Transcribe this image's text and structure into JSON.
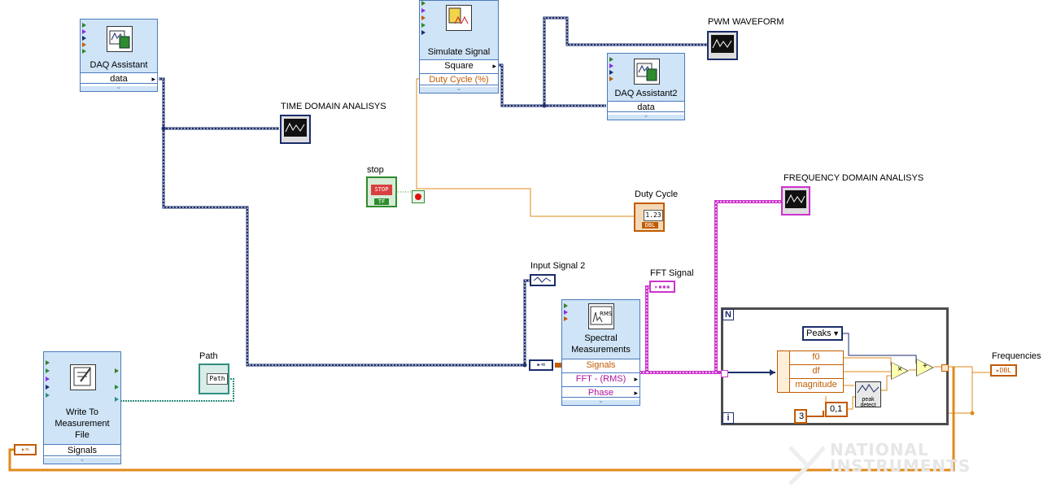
{
  "labels": {
    "time_domain": "TIME DOMAIN ANALISYS",
    "pwm": "PWM WAVEFORM",
    "stop": "stop",
    "duty_cycle": "Duty Cycle",
    "freq_domain": "FREQUENCY DOMAIN ANALISYS",
    "input_signal": "Input Signal 2",
    "fft_signal": "FFT Signal",
    "path": "Path",
    "frequencies": "Frequencies"
  },
  "daq1": {
    "title": "DAQ Assistant",
    "output": "data"
  },
  "daq2": {
    "title": "DAQ Assistant2",
    "output": "data"
  },
  "simulate": {
    "title": "Simulate Signal",
    "type": "Square",
    "param": "Duty Cycle (%)"
  },
  "spectral": {
    "title": "Spectral Measurements",
    "row1": "Signals",
    "row2": "FFT - (RMS)",
    "row3": "Phase",
    "icon_text": "RMS"
  },
  "writefile": {
    "title": "Write To Measurement File",
    "input": "Signals"
  },
  "loop": {
    "count_label": "N",
    "iter_label": "i"
  },
  "peaks_enum": "Peaks",
  "cluster_fields": [
    "f0",
    "df",
    "magnitude"
  ],
  "const_three": "3",
  "const_thresh": "0,1",
  "peak_detect_label": "peak detect",
  "terminals": {
    "stop_text": "STOP",
    "tf_text": "TF",
    "dbl_text": "DBL",
    "duty_value": "1.23",
    "path_text": "Path"
  },
  "watermark": {
    "line1": "NATIONAL",
    "line2": "INSTRUMENTS"
  },
  "colors": {
    "dynamic_wire": "#1b2d6b",
    "dbl_wire": "#e08a1a",
    "pink_wire": "#cc33cc",
    "bool_wire": "#2e8b2e",
    "path_wire": "#2f8f7f"
  }
}
